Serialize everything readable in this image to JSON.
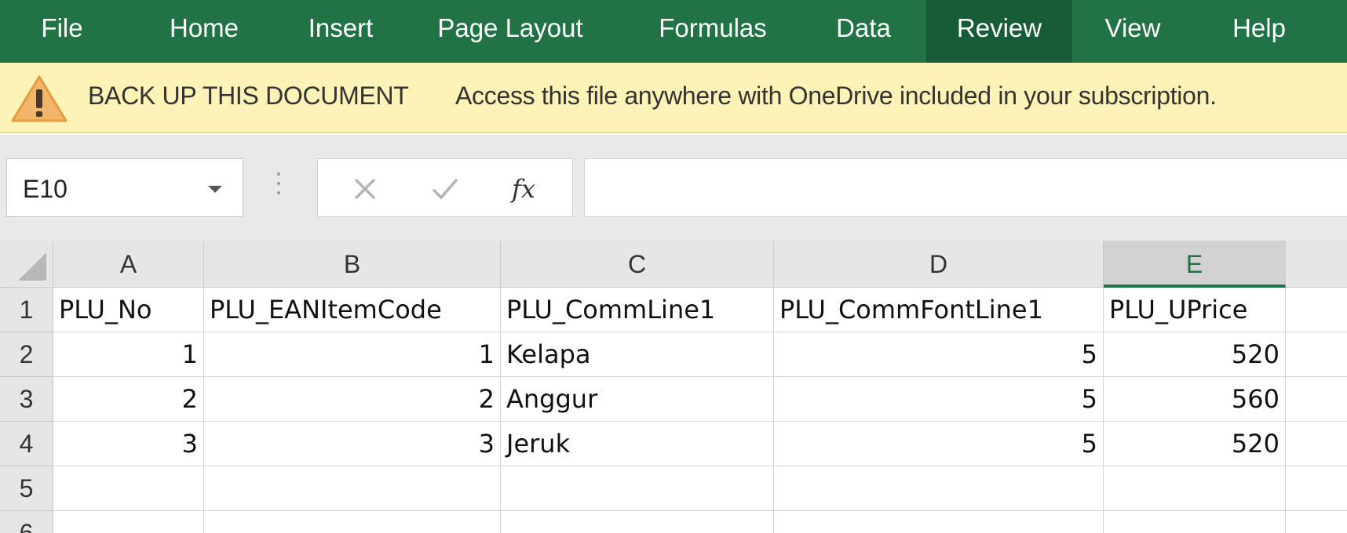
{
  "ribbon": {
    "tabs": [
      {
        "label": "File"
      },
      {
        "label": "Home"
      },
      {
        "label": "Insert"
      },
      {
        "label": "Page Layout"
      },
      {
        "label": "Formulas"
      },
      {
        "label": "Data"
      },
      {
        "label": "Review",
        "active": true
      },
      {
        "label": "View"
      },
      {
        "label": "Help"
      }
    ],
    "color": "#217346",
    "active_color": "#185c37"
  },
  "message_bar": {
    "icon": "warning-icon",
    "title": "BACK UP THIS DOCUMENT",
    "text": "Access this file anywhere with OneDrive included in your subscription.",
    "background": "#fdf3b6"
  },
  "formula_bar": {
    "name_box": "E10",
    "cancel_icon": "✕",
    "enter_icon": "✓",
    "function_icon": "fx",
    "formula": ""
  },
  "sheet": {
    "columns": [
      "A",
      "B",
      "C",
      "D",
      "E"
    ],
    "selected_column": "E",
    "rows": [
      "1",
      "2",
      "3",
      "4",
      "5",
      "6"
    ],
    "cells": [
      [
        "PLU_No",
        "PLU_EANItemCode",
        "PLU_CommLine1",
        "PLU_CommFontLine1",
        "PLU_UPrice"
      ],
      [
        "1",
        "1",
        "Kelapa",
        "5",
        "520"
      ],
      [
        "2",
        "2",
        "Anggur",
        "5",
        "560"
      ],
      [
        "3",
        "3",
        "Jeruk",
        "5",
        "520"
      ],
      [
        "",
        "",
        "",
        "",
        ""
      ],
      [
        "",
        "",
        "",
        "",
        ""
      ]
    ]
  }
}
